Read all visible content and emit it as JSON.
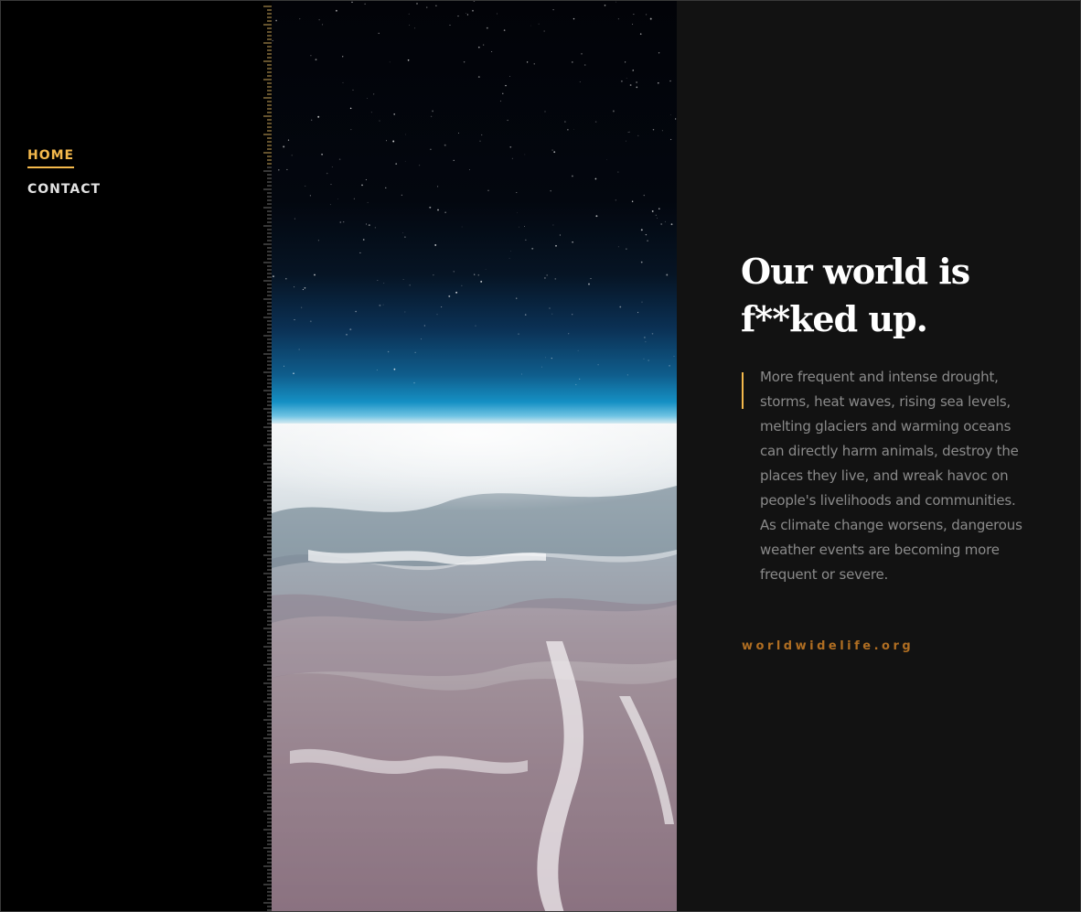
{
  "nav": {
    "items": [
      {
        "label": "HOME",
        "active": true
      },
      {
        "label": "CONTACT",
        "active": false
      }
    ]
  },
  "hero": {
    "image_name": "earth-from-space-photo"
  },
  "content": {
    "headline": "Our world is f**ked up.",
    "quote": "More frequent and intense drought, storms, heat waves, rising sea levels, melting glaciers and warming oceans can directly harm animals, destroy the places they live, and wreak havoc on people's livelihoods and communities. As climate change worsens, dangerous weather events are becoming more frequent or severe.",
    "source": "worldwidelife.org"
  },
  "colors": {
    "accent": "#f4b94c",
    "source_link": "#b06e22",
    "panel_bg": "#121212",
    "sidebar_bg": "#000000"
  }
}
